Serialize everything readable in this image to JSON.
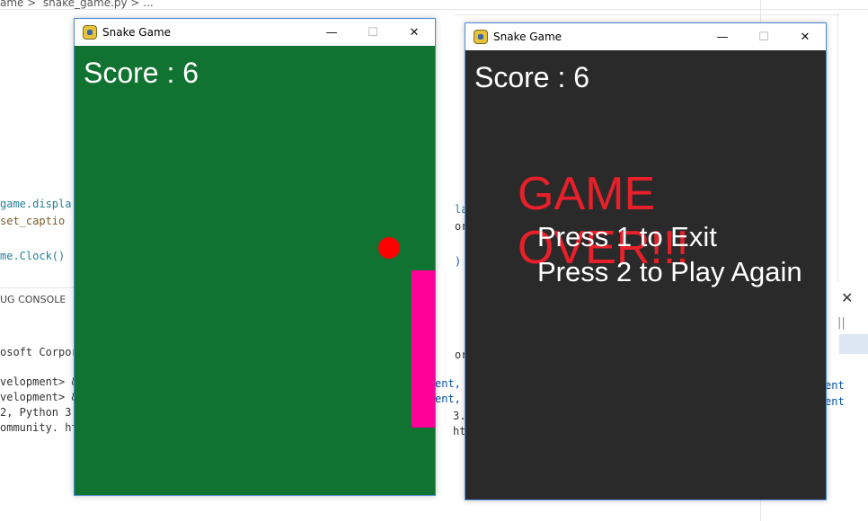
{
  "editor": {
    "breadcrumb": "ame >  snake_game.py > ...",
    "code_left": [
      "game.displa",
      "set_captio",
      "me.Clock()"
    ],
    "code_mid": [
      "la",
      "or",
      ")"
    ],
    "debug_tab": "UG CONSOLE",
    "console_left": [
      "osoft Corpor",
      "velopment> &",
      "velopment> &",
      "2, Python 3.",
      "ommunity. ht"
    ],
    "console_mid": [
      "or",
      "ent, &",
      "ent, &",
      "3.",
      "ht"
    ],
    "console_right": [
      "ent",
      "ent"
    ]
  },
  "windows": [
    {
      "title": "Snake Game",
      "controls": {
        "minimize": "—",
        "maximize": "☐",
        "close": "✕"
      },
      "game": {
        "background": "#117331",
        "score_text": "Score : 6",
        "food_color": "#ff0000",
        "snake_color": "#ff0099"
      }
    },
    {
      "title": "Snake Game",
      "controls": {
        "minimize": "—",
        "maximize": "☐",
        "close": "✕"
      },
      "game": {
        "background": "#2a2a2a",
        "score_text": "Score : 6",
        "game_over_text": "GAME OVER!!!",
        "game_over_color": "#e8202a",
        "option_exit": "Press 1 to Exit",
        "option_play": "Press 2 to Play Again"
      }
    }
  ],
  "side_panel": {
    "close": "✕",
    "pipe": "||"
  }
}
